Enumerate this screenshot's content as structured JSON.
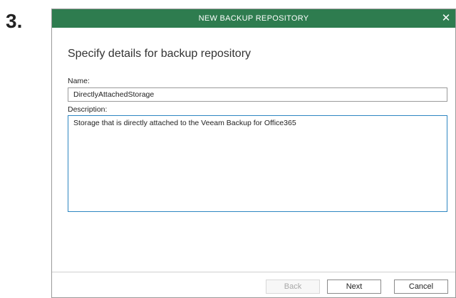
{
  "step": {
    "number": "3."
  },
  "dialog": {
    "title": "NEW BACKUP REPOSITORY",
    "close_symbol": "✕",
    "heading": "Specify details for backup repository",
    "name_label": "Name:",
    "name_value": "DirectlyAttachedStorage",
    "description_label": "Description:",
    "description_value": "Storage that is directly attached to the Veeam Backup for Office365"
  },
  "buttons": {
    "back": "Back",
    "next": "Next",
    "cancel": "Cancel"
  },
  "colors": {
    "titlebar": "#2e7c4f",
    "focus_border": "#2e86c1"
  }
}
